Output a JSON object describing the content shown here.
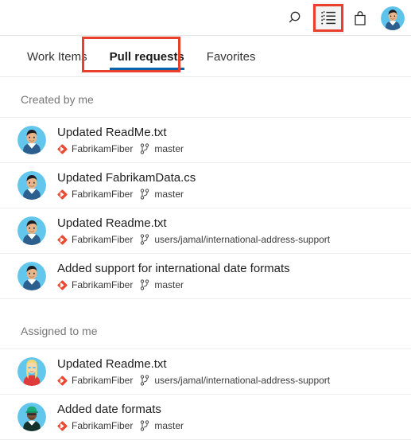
{
  "header": {
    "icons": [
      {
        "name": "search-icon",
        "label": "Search"
      },
      {
        "name": "feed-icon",
        "label": "My work"
      },
      {
        "name": "marketplace-bag-icon",
        "label": "Marketplace"
      }
    ],
    "avatar_label": "User profile"
  },
  "tabs": [
    {
      "label": "Work Items",
      "active": false
    },
    {
      "label": "Pull requests",
      "active": true
    },
    {
      "label": "Favorites",
      "active": false
    }
  ],
  "sections": [
    {
      "title": "Created by me",
      "items": [
        {
          "title": "Updated ReadMe.txt",
          "repo": "FabrikamFiber",
          "branch": "master",
          "avatar": "man-dark-hair"
        },
        {
          "title": "Updated FabrikamData.cs",
          "repo": "FabrikamFiber",
          "branch": "master",
          "avatar": "man-dark-hair"
        },
        {
          "title": "Updated Readme.txt",
          "repo": "FabrikamFiber",
          "branch": "users/jamal/international-address-support",
          "avatar": "man-dark-hair"
        },
        {
          "title": "Added support for international date formats",
          "repo": "FabrikamFiber",
          "branch": "master",
          "avatar": "man-dark-hair"
        }
      ]
    },
    {
      "title": "Assigned to me",
      "items": [
        {
          "title": "Updated Readme.txt",
          "repo": "FabrikamFiber",
          "branch": "users/jamal/international-address-support",
          "avatar": "woman-blonde"
        },
        {
          "title": "Added date formats",
          "repo": "FabrikamFiber",
          "branch": "master",
          "avatar": "man-green-cap"
        }
      ]
    }
  ],
  "colors": {
    "accent_blue": "#0b63ab",
    "annotation_red": "#e8402a",
    "repo_icon_red": "#ea4a33",
    "section_title_gray": "#767676",
    "divider": "#ededed"
  }
}
